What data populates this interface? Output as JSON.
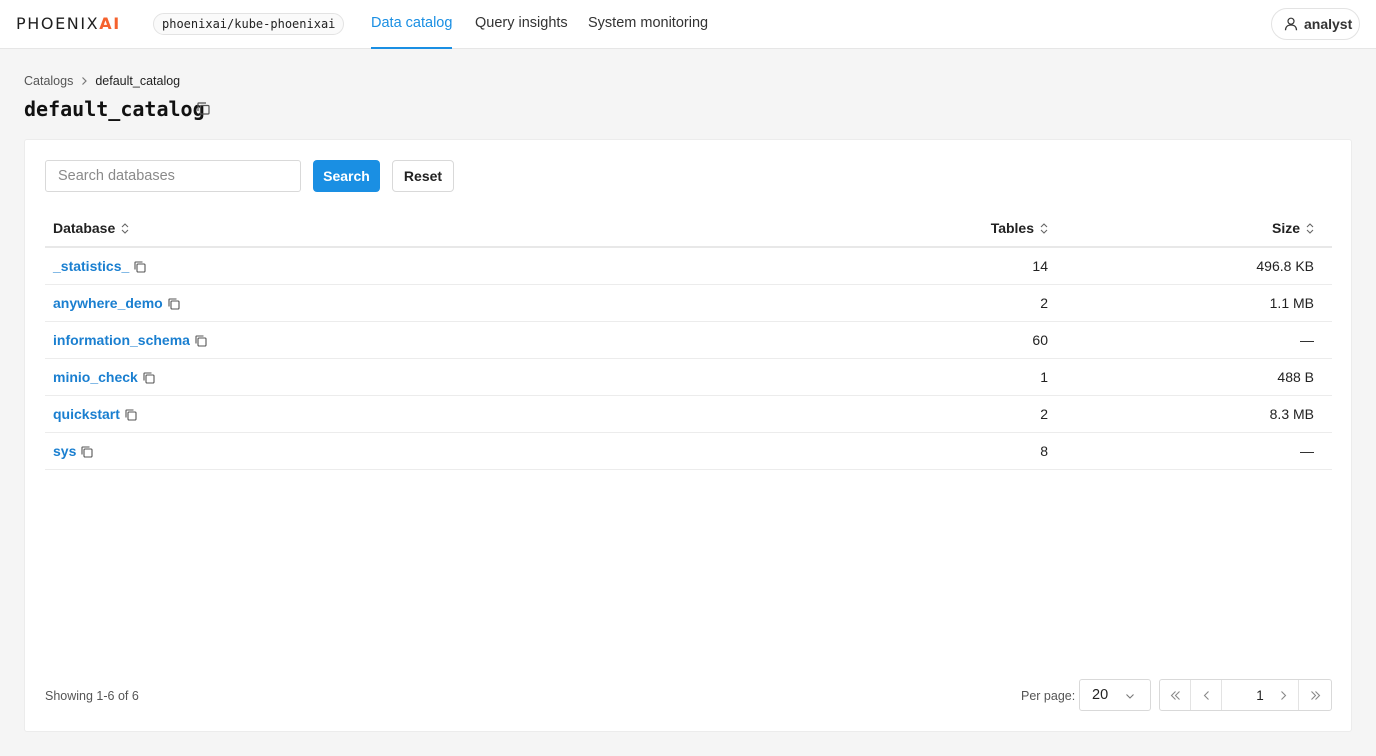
{
  "header": {
    "logo_prefix": "PHOENIX",
    "logo_accent": "AI",
    "cluster": "phoenixai/kube-phoenixai",
    "nav": [
      {
        "label": "Data catalog",
        "active": true
      },
      {
        "label": "Query insights",
        "active": false
      },
      {
        "label": "System monitoring",
        "active": false
      }
    ],
    "user": "analyst"
  },
  "breadcrumb": {
    "root": "Catalogs",
    "current": "default_catalog"
  },
  "page_title": "default_catalog",
  "search": {
    "placeholder": "Search databases",
    "value": "",
    "search_label": "Search",
    "reset_label": "Reset"
  },
  "table": {
    "columns": {
      "database": "Database",
      "tables": "Tables",
      "size": "Size"
    },
    "rows": [
      {
        "database": "_statistics_",
        "tables": "14",
        "size": "496.8 KB"
      },
      {
        "database": "anywhere_demo",
        "tables": "2",
        "size": "1.1 MB"
      },
      {
        "database": "information_schema",
        "tables": "60",
        "size": "—"
      },
      {
        "database": "minio_check",
        "tables": "1",
        "size": "488 B"
      },
      {
        "database": "quickstart",
        "tables": "2",
        "size": "8.3 MB"
      },
      {
        "database": "sys",
        "tables": "8",
        "size": "—"
      }
    ]
  },
  "footer": {
    "showing": "Showing 1-6 of 6",
    "per_page_label": "Per page:",
    "per_page": "20",
    "page": "1"
  },
  "colors": {
    "accent": "#1a8fe3",
    "logo_accent": "#f5622e",
    "link": "#1a7fd0"
  },
  "icons": [
    "user-icon",
    "copy-icon",
    "sort-icon",
    "chevron-right-icon",
    "chevron-down-icon",
    "first-page-icon",
    "prev-page-icon",
    "next-page-icon",
    "last-page-icon"
  ]
}
